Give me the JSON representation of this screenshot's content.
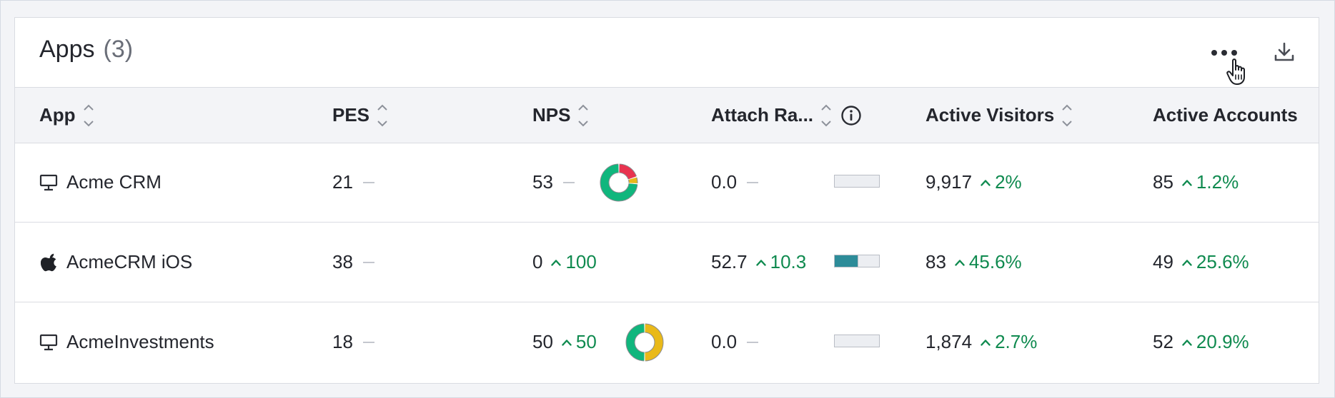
{
  "header": {
    "title": "Apps",
    "count": "(3)",
    "icons": {
      "more": "ellipsis-icon",
      "download": "download-icon"
    }
  },
  "columns": [
    {
      "label": "App",
      "sortable": true
    },
    {
      "label": "PES",
      "sortable": true
    },
    {
      "label": "NPS",
      "sortable": true
    },
    {
      "label": "Attach Ra...",
      "sortable": true,
      "info": true
    },
    {
      "label": "Active Visitors",
      "sortable": true
    },
    {
      "label": "Active Accounts",
      "sortable": false
    }
  ],
  "rows": [
    {
      "platform_icon": "monitor-icon",
      "app": "Acme CRM",
      "pes": "21",
      "nps": "53",
      "nps_delta": "",
      "nps_donut": {
        "detractor": 0.2,
        "passive": 0.06,
        "promoter": 0.74
      },
      "attach": "0.0",
      "attach_delta": "",
      "attach_fill": 0,
      "visitors": "9,917",
      "visitors_delta": "2%",
      "accounts": "85",
      "accounts_delta": "1.2%"
    },
    {
      "platform_icon": "apple-icon",
      "app": "AcmeCRM iOS",
      "pes": "38",
      "nps": "0",
      "nps_delta": "100",
      "nps_donut": null,
      "attach": "52.7",
      "attach_delta": "10.3",
      "attach_fill": 0.527,
      "visitors": "83",
      "visitors_delta": "45.6%",
      "accounts": "49",
      "accounts_delta": "25.6%"
    },
    {
      "platform_icon": "monitor-icon",
      "app": "AcmeInvestments",
      "pes": "18",
      "nps": "50",
      "nps_delta": "50",
      "nps_donut": {
        "detractor": 0,
        "passive": 0.5,
        "promoter": 0.5
      },
      "attach": "0.0",
      "attach_delta": "",
      "attach_fill": 0,
      "visitors": "1,874",
      "visitors_delta": "2.7%",
      "accounts": "52",
      "accounts_delta": "20.9%"
    }
  ],
  "colors": {
    "positive": "#0f8a4f",
    "detractor": "#e8334f",
    "passive": "#e9b919",
    "promoter": "#10b67d",
    "bar_fill": "#2d8c99"
  }
}
